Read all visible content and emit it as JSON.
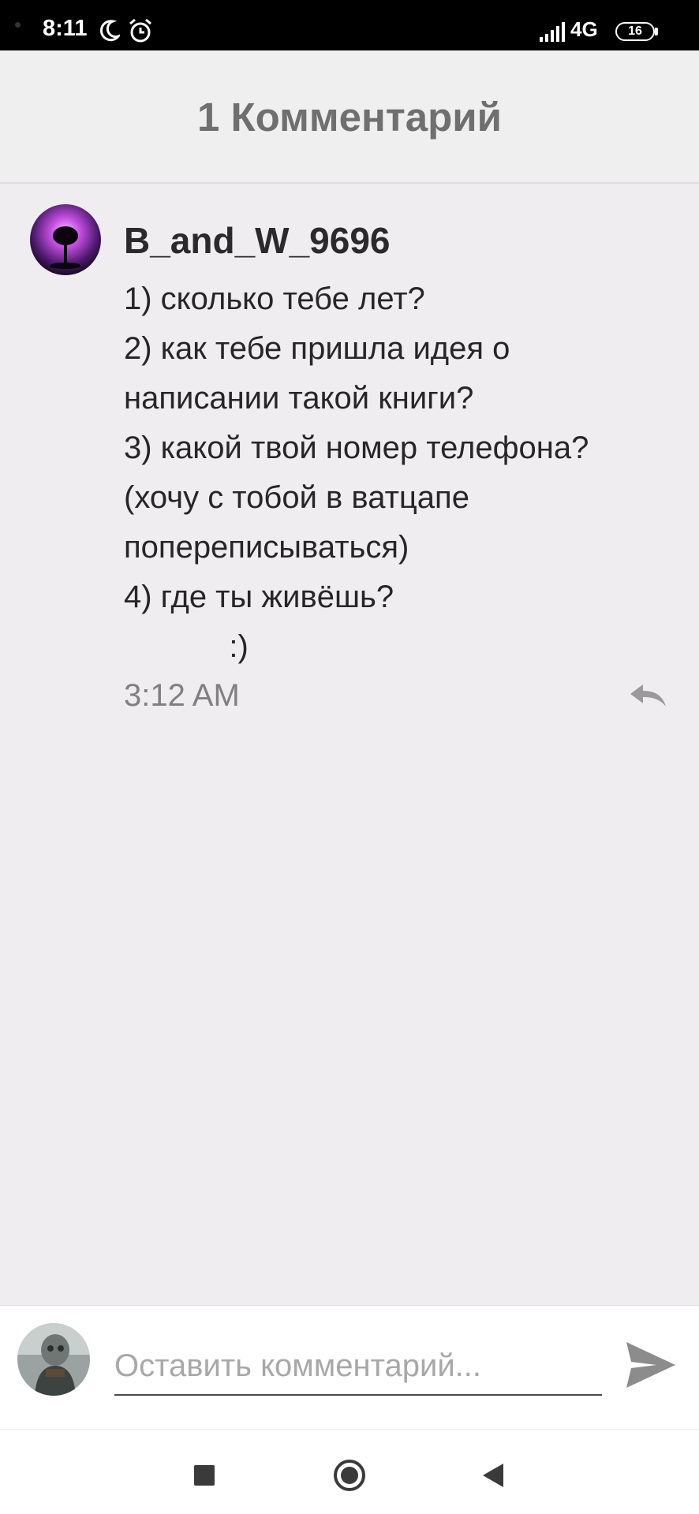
{
  "status_bar": {
    "time": "8:11",
    "network": "4G",
    "battery": "16"
  },
  "header": {
    "title": "1 Комментарий"
  },
  "comment": {
    "author": "B_and_W_9696",
    "lines": [
      "1) сколько тебе лет?",
      "2) как тебе пришла идея о",
      "написании такой книги?",
      "3) какой твой номер телефона?",
      "(хочу с тобой в ватцапе",
      "попереписываться)",
      "4) где ты живёшь?",
      "            :)"
    ],
    "time": "3:12 AM"
  },
  "input": {
    "placeholder": "Оставить комментарий..."
  },
  "icons": {
    "moon": "moon-icon",
    "alarm": "alarm-icon",
    "signal": "signal-icon",
    "reply": "reply-icon",
    "send": "send-icon",
    "recents": "recents-icon",
    "home": "home-icon",
    "back": "back-icon"
  },
  "colors": {
    "background": "#efedf0",
    "header_text": "#6f6f6f",
    "icon_gray": "#909090",
    "status_bar": "#000000"
  }
}
